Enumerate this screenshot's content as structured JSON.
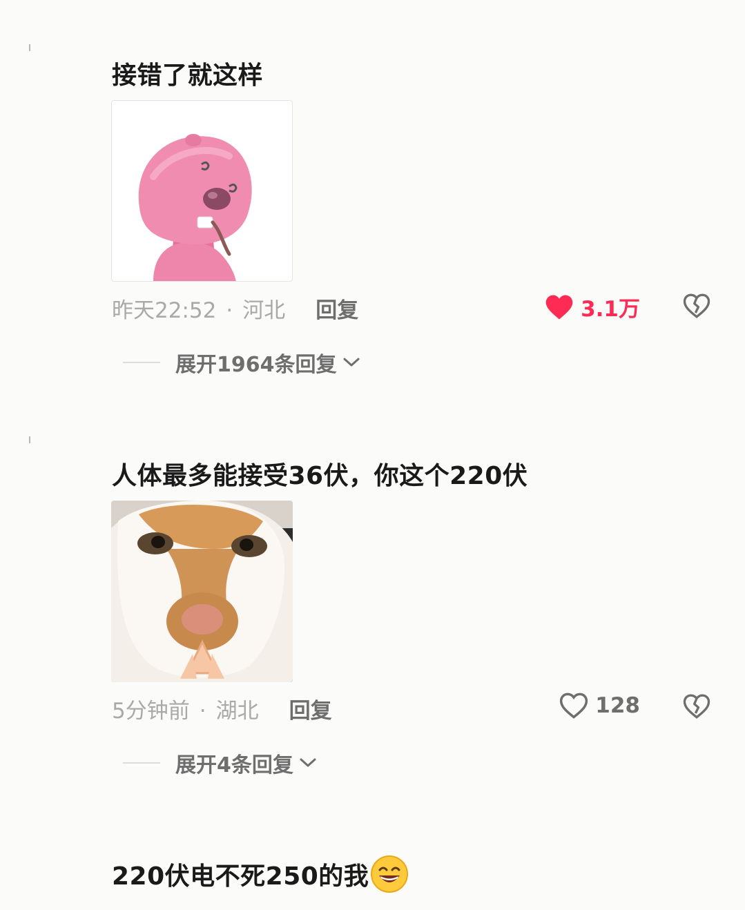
{
  "comments": [
    {
      "text": "接错了就这样",
      "sticker": "pink-beaver-sticker",
      "time": "昨天22:52",
      "separator": "·",
      "region": "河北",
      "reply_label": "回复",
      "likes": "3.1万",
      "liked": true,
      "like_color": "#fe2c55",
      "expand_label": "展开1964条回复"
    },
    {
      "text": "人体最多能接受36伏，你这个220伏",
      "sticker": "orange-cat-sticker",
      "time": "5分钟前",
      "separator": "·",
      "region": "湖北",
      "reply_label": "回复",
      "likes": "128",
      "liked": false,
      "like_color": "#6e6e6e",
      "expand_label": "展开4条回复"
    },
    {
      "text": "220伏电不死250的我",
      "emoji": "grinning-face-emoji"
    }
  ],
  "icons": {
    "like": "heart-icon",
    "dislike": "broken-heart-icon",
    "expand": "chevron-down-icon"
  },
  "colors": {
    "background": "#fbfbfa",
    "text": "#1a1a1a",
    "meta": "#a9a9a9",
    "liked": "#fe2c55"
  }
}
